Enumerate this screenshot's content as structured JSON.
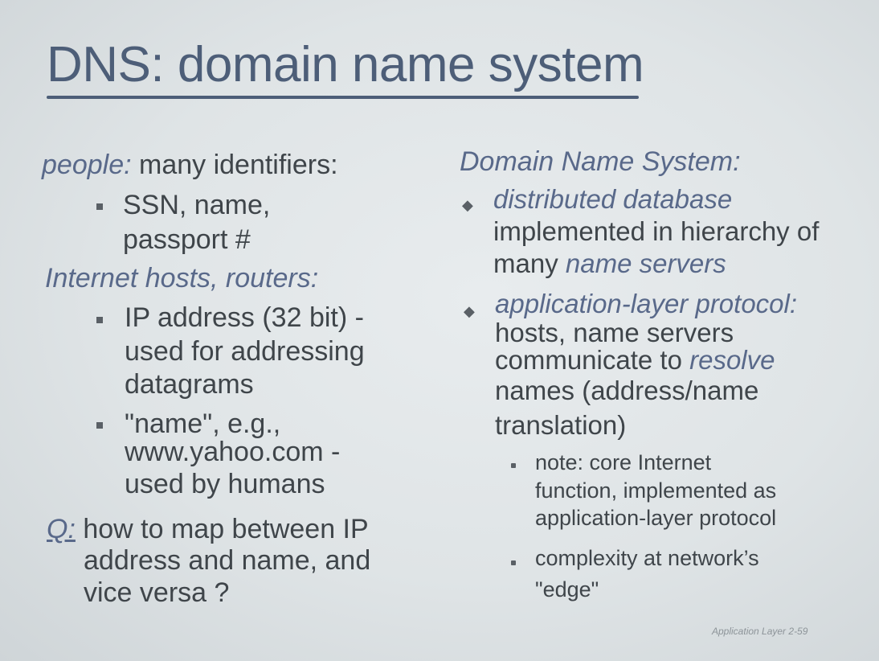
{
  "title": "DNS: domain name system",
  "left": {
    "people_label": "people:",
    "people_text": " many identifiers:",
    "people_items": [
      "SSN, name,",
      "passport #"
    ],
    "hosts_label": "Internet hosts, routers:",
    "ip_lines": [
      "IP address (32 bit) -",
      "used for addressing",
      "datagrams"
    ],
    "name_lines": [
      "\"name\", e.g.,",
      "www.yahoo.com -",
      "used by humans"
    ],
    "q_label": "Q:",
    "q_lines": [
      " how to map between IP",
      "address and name, and",
      "vice versa ?"
    ]
  },
  "right": {
    "heading": "Domain Name System:",
    "b1": {
      "lines_italic": "distributed database",
      "line2": "implemented in hierarchy of",
      "line3_plain": "many ",
      "line3_italic": "name servers"
    },
    "b2": {
      "line1_italic": "application-layer protocol:",
      "line2": "hosts, name servers",
      "line3_plain": "communicate to ",
      "line3_italic": "resolve",
      "line4": "names (address/name",
      "line5": "translation)"
    },
    "sub1": [
      "note: core Internet",
      "function, implemented as",
      "application-layer protocol"
    ],
    "sub2": [
      "complexity at network’s",
      "\"edge\""
    ]
  },
  "footer": "Application Layer 2-59"
}
